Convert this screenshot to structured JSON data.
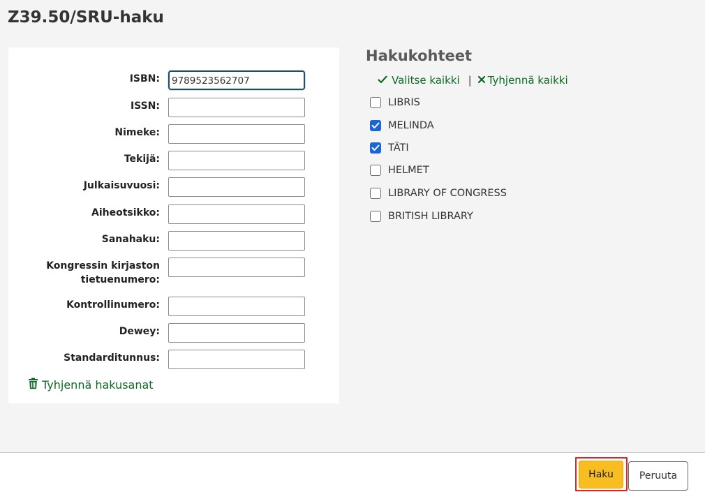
{
  "page": {
    "title": "Z39.50/SRU-haku"
  },
  "form": {
    "fields": [
      {
        "label": "ISBN:",
        "value": "9789523562707"
      },
      {
        "label": "ISSN:",
        "value": ""
      },
      {
        "label": "Nimeke:",
        "value": ""
      },
      {
        "label": "Tekijä:",
        "value": ""
      },
      {
        "label": "Julkaisuvuosi:",
        "value": ""
      },
      {
        "label": "Aiheotsikko:",
        "value": ""
      },
      {
        "label": "Sanahaku:",
        "value": ""
      },
      {
        "label": "Kongressin kirjaston tietuenumero:",
        "value": ""
      },
      {
        "label": "Kontrollinumero:",
        "value": ""
      },
      {
        "label": "Dewey:",
        "value": ""
      },
      {
        "label": "Standarditunnus:",
        "value": ""
      }
    ],
    "clear_terms_label": "Tyhjennä hakusanat"
  },
  "targets": {
    "title": "Hakukohteet",
    "select_all_label": "Valitse kaikki",
    "clear_all_label": "Tyhjennä kaikki",
    "separator": "|",
    "items": [
      {
        "label": "LIBRIS",
        "checked": false
      },
      {
        "label": "MELINDA",
        "checked": true
      },
      {
        "label": "TÄTI",
        "checked": true
      },
      {
        "label": "HELMET",
        "checked": false
      },
      {
        "label": "LIBRARY OF CONGRESS",
        "checked": false
      },
      {
        "label": "BRITISH LIBRARY",
        "checked": false
      }
    ]
  },
  "footer": {
    "search_label": "Haku",
    "cancel_label": "Peruuta"
  },
  "colors": {
    "link_green": "#0b6a24",
    "search_button": "#f7bd21",
    "checkbox_checked": "#1a66d2",
    "highlight_red": "#e02424"
  },
  "icons": {
    "check": "check-icon",
    "cross": "x-icon",
    "trash": "trash-icon"
  }
}
